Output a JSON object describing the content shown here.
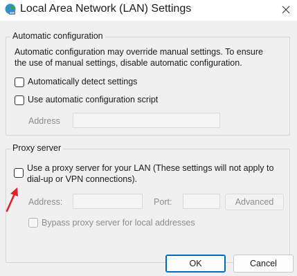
{
  "window": {
    "title": "Local Area Network (LAN) Settings",
    "icon": "globe-network-icon",
    "close_icon": "close-icon"
  },
  "auto_config": {
    "legend": "Automatic configuration",
    "description_line1": "Automatic configuration may override manual settings.  To ensure",
    "description_line2": "the use of manual settings, disable automatic configuration.",
    "detect_label": "Automatically detect settings",
    "detect_checked": false,
    "script_label": "Use automatic configuration script",
    "script_checked": false,
    "address_label": "Address",
    "address_value": ""
  },
  "proxy": {
    "legend": "Proxy server",
    "use_proxy_label_line1": "Use a proxy server for your LAN (These settings will not apply to",
    "use_proxy_label_line2": "dial-up or VPN connections).",
    "use_proxy_checked": false,
    "address_label": "Address:",
    "address_value": "",
    "port_label": "Port:",
    "port_value": "",
    "advanced_label": "Advanced",
    "bypass_label": "Bypass proxy server for local addresses",
    "bypass_checked": false
  },
  "buttons": {
    "ok_label": "OK",
    "cancel_label": "Cancel"
  },
  "colors": {
    "accent": "#0067c0",
    "annotation_arrow": "#e0202a"
  }
}
